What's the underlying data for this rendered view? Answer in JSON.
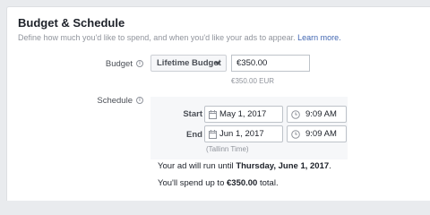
{
  "section": {
    "title": "Budget & Schedule",
    "subtitle": "Define how much you'd like to spend, and when you'd like your ads to appear.",
    "learn_more": "Learn more."
  },
  "budget": {
    "label": "Budget",
    "type": "Lifetime Budget",
    "amount": "€350.00",
    "amount_hint": "€350.00 EUR"
  },
  "schedule": {
    "label": "Schedule",
    "start_label": "Start",
    "start_date": "May 1, 2017",
    "start_time": "9:09 AM",
    "end_label": "End",
    "end_date": "Jun 1, 2017",
    "end_time": "9:09 AM",
    "timezone": "(Tallinn Time)"
  },
  "summary": {
    "run_prefix": "Your ad will run until",
    "run_date": "Thursday, June 1, 2017",
    "run_suffix": ".",
    "spend_prefix": "You'll spend up to",
    "spend_amount": "€350.00",
    "spend_suffix": "total."
  },
  "icons": {
    "info": "info-icon",
    "calendar": "calendar-icon",
    "clock": "clock-icon",
    "dropdown": "caret-down-icon"
  },
  "colors": {
    "link": "#4267b2",
    "muted": "#90949c",
    "background": "#e9ebee"
  }
}
